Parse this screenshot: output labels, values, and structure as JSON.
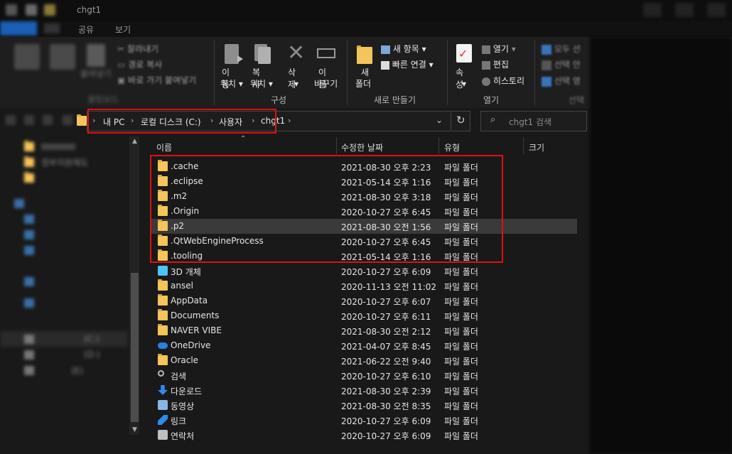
{
  "window": {
    "title": "chgt1"
  },
  "tabs": [
    "공유",
    "보기"
  ],
  "ribbon": {
    "clipboard": {
      "paste_label": "붙여넣기",
      "cut_label": "잘라내기",
      "copy_path_label": "경로 복사",
      "paste_shortcut_label": "바로 가기 붙여넣기",
      "group_label": "클립보드"
    },
    "organize": {
      "move_to_label_1": "이동",
      "move_to_label_2": "위치",
      "copy_to_label_1": "복사",
      "copy_to_label_2": "위치",
      "delete_label": "삭제",
      "rename_label_1": "이름",
      "rename_label_2": "바꾸기",
      "group_label": "구성"
    },
    "new": {
      "new_folder_label_1": "새",
      "new_folder_label_2": "폴더",
      "new_item_label": "새 항목",
      "easy_access_label": "빠른 연결",
      "group_label": "새로 만들기"
    },
    "open": {
      "properties_label": "속성",
      "open_label": "열기",
      "edit_label": "편집",
      "history_label": "히스토리",
      "group_label": "열기"
    },
    "select": {
      "select_all_label": "모두 선",
      "select_none_label": "선택 안",
      "invert_label": "선택 영",
      "group_label": "선택"
    }
  },
  "address": {
    "crumbs": [
      "내 PC",
      "로컬 디스크 (C:)",
      "사용자",
      "chgt1"
    ],
    "search_placeholder": "chgt1 검색"
  },
  "columns": {
    "name": "이름",
    "date": "수정한 날짜",
    "type": "유형",
    "size": "크기"
  },
  "nav": {
    "items": [
      "정부지원제도",
      "(C:)",
      "(D:)",
      "(E)"
    ]
  },
  "files": [
    {
      "name": ".cache",
      "date": "2021-08-30 오후 2:23",
      "type": "파일 폴더",
      "icon": "folder-icon"
    },
    {
      "name": ".eclipse",
      "date": "2021-05-14 오후 1:16",
      "type": "파일 폴더",
      "icon": "folder-icon"
    },
    {
      "name": ".m2",
      "date": "2021-08-30 오후 3:18",
      "type": "파일 폴더",
      "icon": "folder-icon"
    },
    {
      "name": ".Origin",
      "date": "2020-10-27 오후 6:45",
      "type": "파일 폴더",
      "icon": "folder-icon"
    },
    {
      "name": ".p2",
      "date": "2021-08-30 오전 1:56",
      "type": "파일 폴더",
      "icon": "folder-icon",
      "selected": true
    },
    {
      "name": ".QtWebEngineProcess",
      "date": "2020-10-27 오후 6:45",
      "type": "파일 폴더",
      "icon": "folder-icon"
    },
    {
      "name": ".tooling",
      "date": "2021-05-14 오후 1:16",
      "type": "파일 폴더",
      "icon": "folder-icon"
    },
    {
      "name": "3D 개체",
      "date": "2020-10-27 오후 6:09",
      "type": "파일 폴더",
      "icon": "3d-objects-icon"
    },
    {
      "name": "ansel",
      "date": "2020-11-13 오전 11:02",
      "type": "파일 폴더",
      "icon": "folder-icon"
    },
    {
      "name": "AppData",
      "date": "2020-10-27 오후 6:07",
      "type": "파일 폴더",
      "icon": "folder-icon"
    },
    {
      "name": "Documents",
      "date": "2020-10-27 오후 6:11",
      "type": "파일 폴더",
      "icon": "folder-icon"
    },
    {
      "name": "NAVER VIBE",
      "date": "2021-08-30 오전 2:12",
      "type": "파일 폴더",
      "icon": "folder-icon"
    },
    {
      "name": "OneDrive",
      "date": "2021-04-07 오후 8:45",
      "type": "파일 폴더",
      "icon": "onedrive-icon"
    },
    {
      "name": "Oracle",
      "date": "2021-06-22 오전 9:40",
      "type": "파일 폴더",
      "icon": "folder-icon"
    },
    {
      "name": "검색",
      "date": "2020-10-27 오후 6:10",
      "type": "파일 폴더",
      "icon": "search-folder-icon"
    },
    {
      "name": "다운로드",
      "date": "2021-08-30 오후 2:39",
      "type": "파일 폴더",
      "icon": "download-icon"
    },
    {
      "name": "동영상",
      "date": "2021-08-30 오전 8:35",
      "type": "파일 폴더",
      "icon": "video-icon"
    },
    {
      "name": "링크",
      "date": "2020-10-27 오후 6:09",
      "type": "파일 폴더",
      "icon": "link-icon"
    },
    {
      "name": "연락처",
      "date": "2020-10-27 오후 6:09",
      "type": "파일 폴더",
      "icon": "contacts-icon"
    }
  ],
  "colors": {
    "highlight": "#e01010",
    "folder": "#f3c55a",
    "selected_row": "#3a3a3a"
  }
}
